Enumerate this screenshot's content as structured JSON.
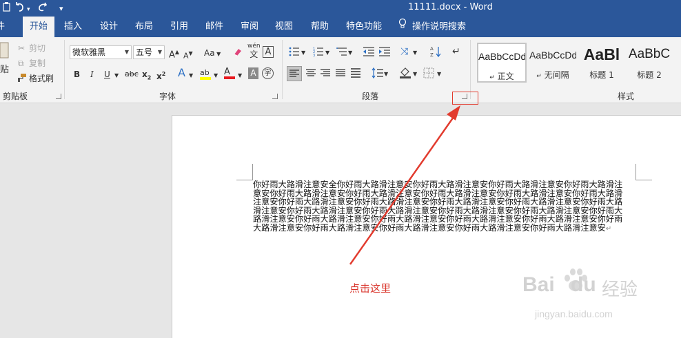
{
  "title_bar": {
    "document_title": "11111.docx",
    "app_name": "Word",
    "separator": " - "
  },
  "tabs": [
    {
      "label": "件"
    },
    {
      "label": "开始"
    },
    {
      "label": "插入"
    },
    {
      "label": "设计"
    },
    {
      "label": "布局"
    },
    {
      "label": "引用"
    },
    {
      "label": "邮件"
    },
    {
      "label": "审阅"
    },
    {
      "label": "视图"
    },
    {
      "label": "帮助"
    },
    {
      "label": "特色功能"
    }
  ],
  "tell_me": {
    "label": "操作说明搜索",
    "icon": "lightbulb-icon"
  },
  "clipboard": {
    "group_label": "剪贴板",
    "paste_label": "贴",
    "cut_label": "剪切",
    "copy_label": "复制",
    "format_painter_label": "格式刷"
  },
  "font": {
    "group_label": "字体",
    "font_name": "微软雅黑",
    "font_size": "五号",
    "grow_glyph": "A",
    "shrink_glyph": "A",
    "case_glyph": "Aa",
    "pinyin_glyph": "wén",
    "pinyin_char": "文",
    "border_glyph": "A",
    "bold": "B",
    "italic": "I",
    "underline": "U",
    "strike": "abc",
    "subscript": "x",
    "subscript_sub": "2",
    "superscript": "x",
    "superscript_sup": "2",
    "effects_glyph": "A",
    "highlight_glyph": "ab",
    "font_color_glyph": "A",
    "shading_glyph": "A",
    "enclose_glyph": "字",
    "highlight_color": "#ffff00",
    "font_color": "#e8191f"
  },
  "paragraph": {
    "group_label": "段落"
  },
  "styles": {
    "group_label": "样式",
    "items": [
      {
        "sample": "AaBbCcDd",
        "name": "正文",
        "mark": "↵"
      },
      {
        "sample": "AaBbCcDd",
        "name": "无间隔",
        "mark": "↵"
      },
      {
        "sample": "AaBl",
        "name": "标题 1",
        "mark": ""
      },
      {
        "sample": "AaBbC",
        "name": "标题 2",
        "mark": ""
      }
    ]
  },
  "document": {
    "body_text": "你好雨大路滑注意安全你好雨大路滑注意安你好雨大路滑注意安你好雨大路滑注意安你好雨大路滑注意安你好雨大路滑注意安你好雨大路滑注意安你好雨大路滑注意安你好雨大路滑注意安你好雨大路滑注意安你好雨大路滑注意安你好雨大路滑注意安你好雨大路滑注意安你好雨大路滑注意安你好雨大路滑注意安你好雨大路滑注意安你好雨大路滑注意安你好雨大路滑注意安你好雨大路滑注意安你好雨大路滑注意安你好雨大路滑注意安你好雨大路滑注意安你好雨大路滑注意安你好雨大路滑注意安你好雨大路滑注意安你好雨大路滑注意安你好雨大路滑注意安你好雨大路滑注意安你好雨大路滑注意安",
    "paragraph_mark": "↵"
  },
  "annotation": {
    "text": "点击这里",
    "color": "#d9342b"
  },
  "watermark": {
    "logo_text": "Bai",
    "logo_text_2": "du",
    "cn_text": "经验",
    "url": "jingyan.baidu.com"
  },
  "colors": {
    "brand": "#2b579a",
    "ribbon_bg": "#f3f3f3",
    "accent_red": "#e23b2e"
  }
}
